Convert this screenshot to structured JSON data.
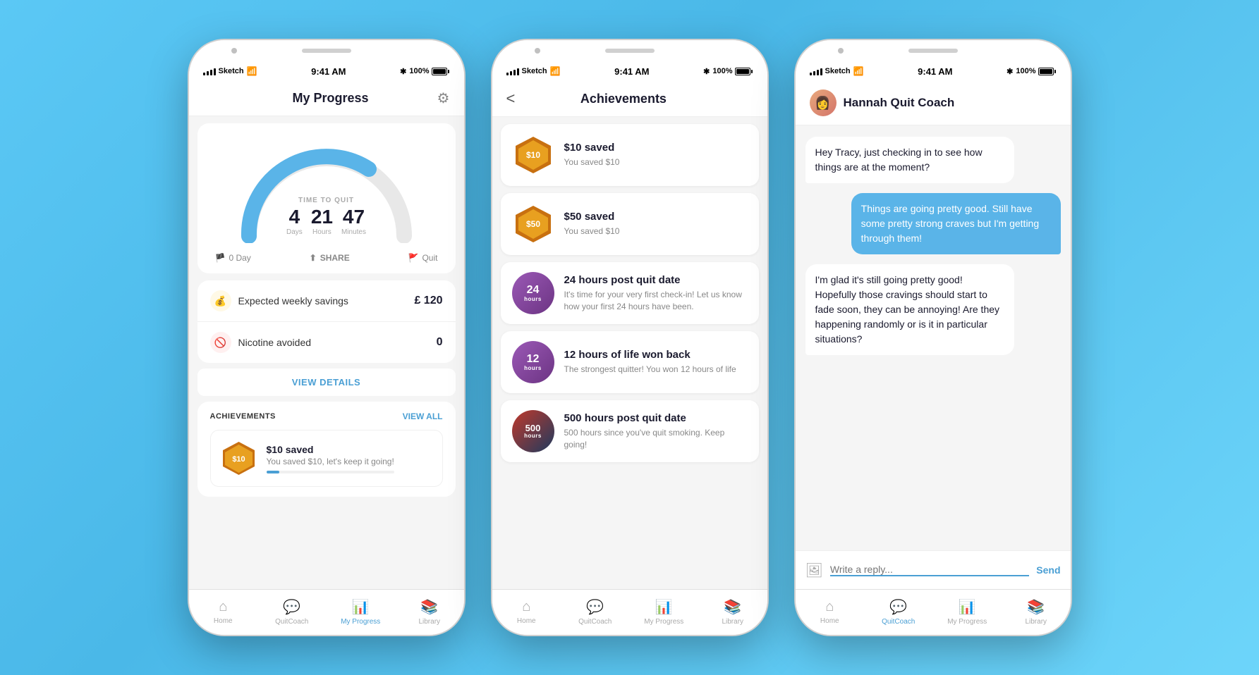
{
  "background": {
    "gradient_start": "#5bc8f5",
    "gradient_end": "#4ab8e8"
  },
  "phones": [
    {
      "id": "phone-progress",
      "status_bar": {
        "carrier": "Sketch",
        "time": "9:41 AM",
        "battery": "100%",
        "bluetooth": "✱"
      },
      "header": {
        "title": "My Progress",
        "has_settings": true
      },
      "gauge": {
        "label": "TIME TO QUIT",
        "days": "4",
        "hours": "21",
        "minutes": "47",
        "days_label": "Days",
        "hours_label": "Hours",
        "minutes_label": "Minutes"
      },
      "gauge_actions": {
        "left": "0 Day",
        "middle": "SHARE",
        "right": "Quit"
      },
      "stats": [
        {
          "icon": "💰",
          "icon_bg": "#fff9e6",
          "label": "Expected weekly savings",
          "value": "£ 120"
        },
        {
          "icon": "🚫",
          "icon_bg": "#fff0f0",
          "label": "Nicotine avoided",
          "value": "0"
        }
      ],
      "view_details_label": "VIEW DETAILS",
      "achievements_section": {
        "title": "ACHIEVEMENTS",
        "view_all": "VIEW ALL",
        "item": {
          "badge_text": "$10",
          "badge_color": "#e8a020",
          "title": "$10 saved",
          "description": "You saved $10, let's keep it going!",
          "progress": 10
        }
      },
      "tab_bar": [
        {
          "icon": "⌂",
          "label": "Home",
          "active": false
        },
        {
          "icon": "💬",
          "label": "QuitCoach",
          "active": false
        },
        {
          "icon": "📊",
          "label": "My Progress",
          "active": true
        },
        {
          "icon": "📚",
          "label": "Library",
          "active": false
        }
      ]
    },
    {
      "id": "phone-achievements",
      "status_bar": {
        "carrier": "Sketch",
        "time": "9:41 AM",
        "battery": "100%",
        "bluetooth": "✱"
      },
      "header": {
        "title": "Achievements",
        "has_back": true
      },
      "achievements": [
        {
          "type": "hex",
          "badge_text": "$10",
          "badge_color_top": "#e8a020",
          "badge_color_bottom": "#c87010",
          "title": "$10 saved",
          "description": "You saved $10"
        },
        {
          "type": "hex",
          "badge_text": "$50",
          "badge_color_top": "#e8a020",
          "badge_color_bottom": "#c87010",
          "title": "$50 saved",
          "description": "You saved $10"
        },
        {
          "type": "circle",
          "badge_num": "24",
          "badge_unit": "hours",
          "badge_color_top": "#8b5cf6",
          "badge_color_bottom": "#6d28d9",
          "title": "24 hours post quit date",
          "description": "It's time for your very first check-in! Let us know how your first 24 hours have been."
        },
        {
          "type": "circle",
          "badge_num": "12",
          "badge_unit": "hours",
          "badge_color_top": "#8b5cf6",
          "badge_color_bottom": "#6d28d9",
          "title": "12 hours of life won back",
          "description": "The strongest quitter!\nYou won 12 hours of life"
        },
        {
          "type": "circle",
          "badge_num": "500",
          "badge_unit": "hours",
          "badge_color_top": "#1e3a5f",
          "badge_color_bottom": "#c0392b",
          "title": "500 hours post quit date",
          "description": "500 hours since you've quit smoking. Keep going!"
        }
      ],
      "tab_bar": [
        {
          "icon": "⌂",
          "label": "Home",
          "active": false
        },
        {
          "icon": "💬",
          "label": "QuitCoach",
          "active": false
        },
        {
          "icon": "📊",
          "label": "My Progress",
          "active": false
        },
        {
          "icon": "📚",
          "label": "Library",
          "active": false
        }
      ]
    },
    {
      "id": "phone-chat",
      "status_bar": {
        "carrier": "Sketch",
        "time": "9:41 AM",
        "battery": "100%",
        "bluetooth": "✱"
      },
      "header": {
        "coach_name": "Hannah Quit Coach"
      },
      "messages": [
        {
          "side": "left",
          "text": "Hey Tracy, just checking in to see how things are at the moment?"
        },
        {
          "side": "right",
          "text": "Things are going pretty good. Still have some pretty strong craves but I'm getting through them!"
        },
        {
          "side": "left",
          "text": "I'm glad it's still going pretty good! Hopefully those cravings should start to fade soon, they can be annoying! Are they happening randomly or is it in particular situations?"
        }
      ],
      "chat_input": {
        "placeholder": "Write a reply...",
        "send_label": "Send",
        "image_icon": "🖼"
      },
      "tab_bar": [
        {
          "icon": "⌂",
          "label": "Home",
          "active": false
        },
        {
          "icon": "💬",
          "label": "QuitCoach",
          "active": true
        },
        {
          "icon": "📊",
          "label": "My Progress",
          "active": false
        },
        {
          "icon": "📚",
          "label": "Library",
          "active": false
        }
      ]
    }
  ]
}
